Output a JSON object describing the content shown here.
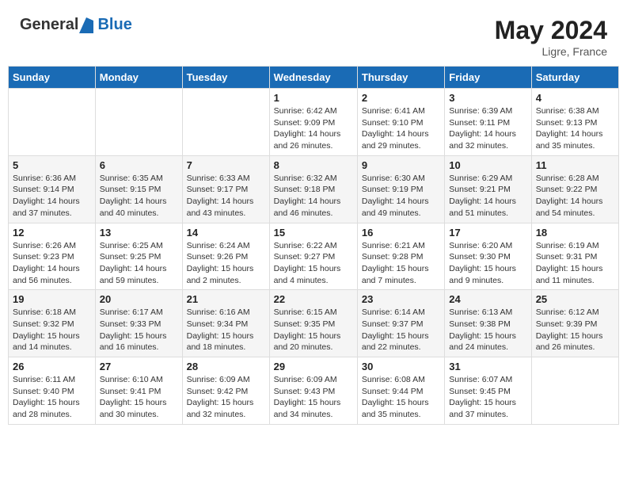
{
  "header": {
    "logo_general": "General",
    "logo_blue": "Blue",
    "month_year": "May 2024",
    "location": "Ligre, France"
  },
  "weekdays": [
    "Sunday",
    "Monday",
    "Tuesday",
    "Wednesday",
    "Thursday",
    "Friday",
    "Saturday"
  ],
  "weeks": [
    [
      {
        "day": "",
        "info": ""
      },
      {
        "day": "",
        "info": ""
      },
      {
        "day": "",
        "info": ""
      },
      {
        "day": "1",
        "info": "Sunrise: 6:42 AM\nSunset: 9:09 PM\nDaylight: 14 hours and 26 minutes."
      },
      {
        "day": "2",
        "info": "Sunrise: 6:41 AM\nSunset: 9:10 PM\nDaylight: 14 hours and 29 minutes."
      },
      {
        "day": "3",
        "info": "Sunrise: 6:39 AM\nSunset: 9:11 PM\nDaylight: 14 hours and 32 minutes."
      },
      {
        "day": "4",
        "info": "Sunrise: 6:38 AM\nSunset: 9:13 PM\nDaylight: 14 hours and 35 minutes."
      }
    ],
    [
      {
        "day": "5",
        "info": "Sunrise: 6:36 AM\nSunset: 9:14 PM\nDaylight: 14 hours and 37 minutes."
      },
      {
        "day": "6",
        "info": "Sunrise: 6:35 AM\nSunset: 9:15 PM\nDaylight: 14 hours and 40 minutes."
      },
      {
        "day": "7",
        "info": "Sunrise: 6:33 AM\nSunset: 9:17 PM\nDaylight: 14 hours and 43 minutes."
      },
      {
        "day": "8",
        "info": "Sunrise: 6:32 AM\nSunset: 9:18 PM\nDaylight: 14 hours and 46 minutes."
      },
      {
        "day": "9",
        "info": "Sunrise: 6:30 AM\nSunset: 9:19 PM\nDaylight: 14 hours and 49 minutes."
      },
      {
        "day": "10",
        "info": "Sunrise: 6:29 AM\nSunset: 9:21 PM\nDaylight: 14 hours and 51 minutes."
      },
      {
        "day": "11",
        "info": "Sunrise: 6:28 AM\nSunset: 9:22 PM\nDaylight: 14 hours and 54 minutes."
      }
    ],
    [
      {
        "day": "12",
        "info": "Sunrise: 6:26 AM\nSunset: 9:23 PM\nDaylight: 14 hours and 56 minutes."
      },
      {
        "day": "13",
        "info": "Sunrise: 6:25 AM\nSunset: 9:25 PM\nDaylight: 14 hours and 59 minutes."
      },
      {
        "day": "14",
        "info": "Sunrise: 6:24 AM\nSunset: 9:26 PM\nDaylight: 15 hours and 2 minutes."
      },
      {
        "day": "15",
        "info": "Sunrise: 6:22 AM\nSunset: 9:27 PM\nDaylight: 15 hours and 4 minutes."
      },
      {
        "day": "16",
        "info": "Sunrise: 6:21 AM\nSunset: 9:28 PM\nDaylight: 15 hours and 7 minutes."
      },
      {
        "day": "17",
        "info": "Sunrise: 6:20 AM\nSunset: 9:30 PM\nDaylight: 15 hours and 9 minutes."
      },
      {
        "day": "18",
        "info": "Sunrise: 6:19 AM\nSunset: 9:31 PM\nDaylight: 15 hours and 11 minutes."
      }
    ],
    [
      {
        "day": "19",
        "info": "Sunrise: 6:18 AM\nSunset: 9:32 PM\nDaylight: 15 hours and 14 minutes."
      },
      {
        "day": "20",
        "info": "Sunrise: 6:17 AM\nSunset: 9:33 PM\nDaylight: 15 hours and 16 minutes."
      },
      {
        "day": "21",
        "info": "Sunrise: 6:16 AM\nSunset: 9:34 PM\nDaylight: 15 hours and 18 minutes."
      },
      {
        "day": "22",
        "info": "Sunrise: 6:15 AM\nSunset: 9:35 PM\nDaylight: 15 hours and 20 minutes."
      },
      {
        "day": "23",
        "info": "Sunrise: 6:14 AM\nSunset: 9:37 PM\nDaylight: 15 hours and 22 minutes."
      },
      {
        "day": "24",
        "info": "Sunrise: 6:13 AM\nSunset: 9:38 PM\nDaylight: 15 hours and 24 minutes."
      },
      {
        "day": "25",
        "info": "Sunrise: 6:12 AM\nSunset: 9:39 PM\nDaylight: 15 hours and 26 minutes."
      }
    ],
    [
      {
        "day": "26",
        "info": "Sunrise: 6:11 AM\nSunset: 9:40 PM\nDaylight: 15 hours and 28 minutes."
      },
      {
        "day": "27",
        "info": "Sunrise: 6:10 AM\nSunset: 9:41 PM\nDaylight: 15 hours and 30 minutes."
      },
      {
        "day": "28",
        "info": "Sunrise: 6:09 AM\nSunset: 9:42 PM\nDaylight: 15 hours and 32 minutes."
      },
      {
        "day": "29",
        "info": "Sunrise: 6:09 AM\nSunset: 9:43 PM\nDaylight: 15 hours and 34 minutes."
      },
      {
        "day": "30",
        "info": "Sunrise: 6:08 AM\nSunset: 9:44 PM\nDaylight: 15 hours and 35 minutes."
      },
      {
        "day": "31",
        "info": "Sunrise: 6:07 AM\nSunset: 9:45 PM\nDaylight: 15 hours and 37 minutes."
      },
      {
        "day": "",
        "info": ""
      }
    ]
  ]
}
